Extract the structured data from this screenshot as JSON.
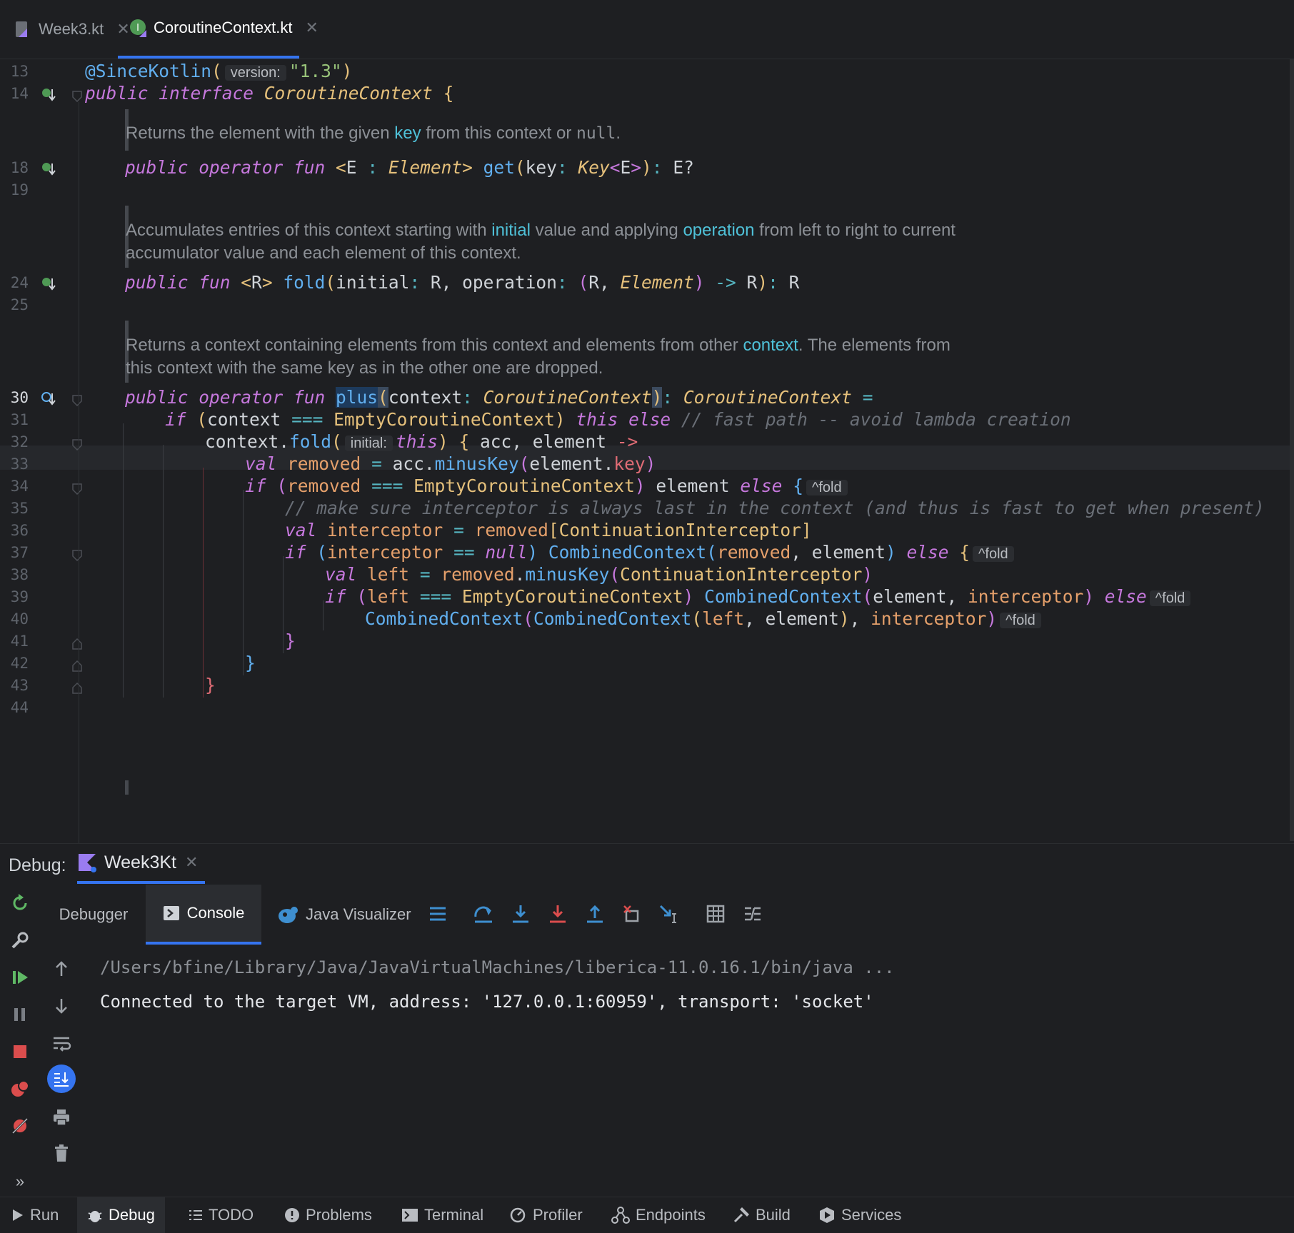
{
  "tabs": [
    {
      "label": "Week3.kt",
      "close": "✕"
    },
    {
      "label": "CoroutineContext.kt",
      "close": "✕"
    }
  ],
  "editor": {
    "line_numbers": [
      "13",
      "14",
      "18",
      "19",
      "24",
      "25",
      "30",
      "31",
      "32",
      "33",
      "34",
      "35",
      "36",
      "37",
      "38",
      "39",
      "40",
      "41",
      "42",
      "43",
      "44"
    ],
    "docs": [
      {
        "pre": "Returns the element with the given ",
        "hl": "key",
        "mid": " from this context or ",
        "code": "null",
        "post": "."
      },
      {
        "pre": "Accumulates entries of this context starting with ",
        "hl1": "initial",
        "mid": " value and applying ",
        "hl2": "operation",
        "post": " from left to right to current",
        "line2": "accumulator value and each element of this context."
      },
      {
        "pre": "Returns a context containing elements from this context and elements from other ",
        "hl": "context",
        "post": ". The elements from",
        "line2": "this context with the same key as in the other one are dropped."
      }
    ],
    "hints": {
      "version": "version:",
      "initial": "initial:",
      "fold": "^fold"
    }
  },
  "debug": {
    "label": "Debug:",
    "run_config": "Week3Kt",
    "close": "✕",
    "subtabs": [
      "Debugger",
      "Console",
      "Java Visualizer"
    ],
    "console_lines": [
      "/Users/bfine/Library/Java/JavaVirtualMachines/liberica-11.0.16.1/bin/java ...",
      "Connected to the target VM, address: '127.0.0.1:60959', transport: 'socket'"
    ],
    "more": "»"
  },
  "bottom_tools": [
    "Run",
    "Debug",
    "TODO",
    "Problems",
    "Terminal",
    "Profiler",
    "Endpoints",
    "Build",
    "Services"
  ],
  "colors": {
    "accent": "#3574f0",
    "background": "#1e1f22",
    "keyword": "#c678dd",
    "type": "#e5c07b",
    "function": "#61afef",
    "string": "#98c379"
  }
}
